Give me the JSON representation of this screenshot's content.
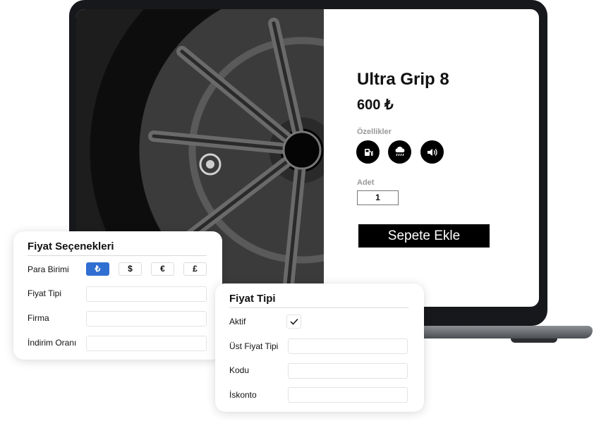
{
  "product": {
    "title": "Ultra Grip 8",
    "price": "600 ₺",
    "features_label": "Özellikler",
    "features": [
      {
        "icon": "fuel-pump-icon"
      },
      {
        "icon": "rain-cloud-icon"
      },
      {
        "icon": "sound-icon"
      }
    ],
    "quantity_label": "Adet",
    "quantity_value": "1",
    "add_to_cart_label": "Sepete Ekle"
  },
  "price_options": {
    "title": "Fiyat Seçenekleri",
    "currency_label": "Para Birimi",
    "currencies": [
      {
        "symbol": "₺",
        "active": true
      },
      {
        "symbol": "$",
        "active": false
      },
      {
        "symbol": "€",
        "active": false
      },
      {
        "symbol": "£",
        "active": false
      }
    ],
    "price_type_label": "Fiyat Tipi",
    "company_label": "Firma",
    "discount_label": "İndirim Oranı"
  },
  "price_type": {
    "title": "Fiyat Tipi",
    "active_label": "Aktif",
    "active_checked": true,
    "parent_type_label": "Üst Fiyat Tipi",
    "code_label": "Kodu",
    "discount_label": "İskonto"
  },
  "colors": {
    "accent": "#2f6fd1",
    "button": "#000000",
    "laptop": "#16181b"
  }
}
